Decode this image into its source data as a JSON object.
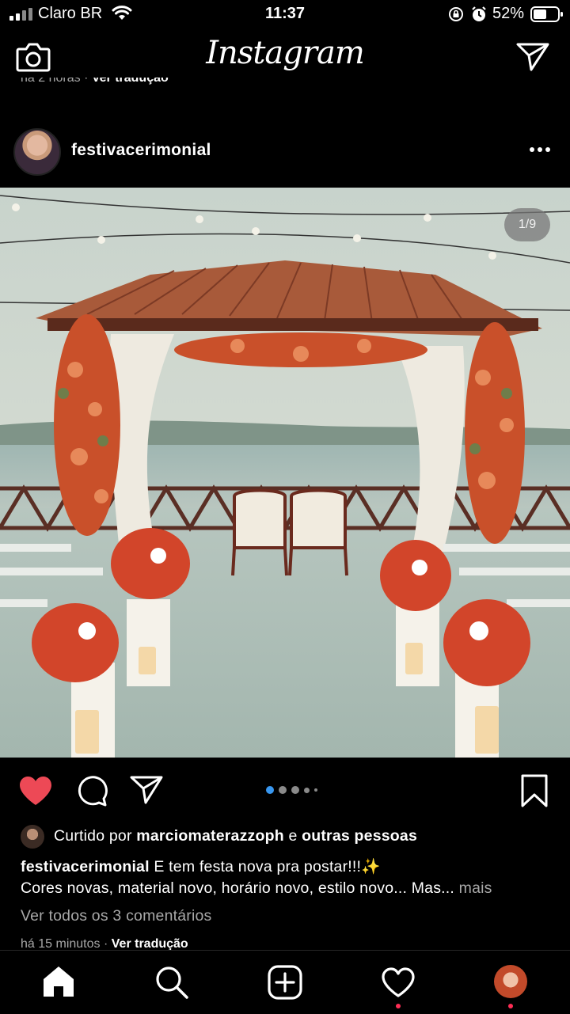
{
  "status_bar": {
    "carrier": "Claro BR",
    "time": "11:37",
    "battery_percent": "52%",
    "icons": [
      "signal-icon",
      "wifi-icon",
      "screen-lock-icon",
      "alarm-icon",
      "battery-icon"
    ]
  },
  "top_nav": {
    "logo": "Instagram",
    "icons": [
      "camera-icon",
      "direct-message-icon"
    ]
  },
  "previous_post": {
    "time_ago": "há 2 horas",
    "translate_label": "Ver tradução"
  },
  "post": {
    "username": "festivacerimonial",
    "photo_counter": "1/9",
    "carousel": {
      "current_index": 1,
      "dot_count": 5
    },
    "liked": true,
    "liked_by_prefix": "Curtido por",
    "liked_by_user": "marciomaterazzoph",
    "liked_by_suffix_connector": "e",
    "liked_by_others": "outras pessoas",
    "caption_username": "festivacerimonial",
    "caption_text": "E tem festa nova pra postar!!!✨",
    "caption_line2": "Cores novas, material novo, horário novo, estilo novo... Mas...",
    "more_label": "mais",
    "view_comments": "Ver todos os 3 comentários",
    "time_ago": "há 15 minutos",
    "translate_label": "Ver tradução"
  },
  "tab_bar": {
    "tabs": [
      "home-icon",
      "search-icon",
      "new-post-icon",
      "activity-icon",
      "profile-avatar"
    ],
    "active": "home-icon"
  },
  "colors": {
    "background": "#000000",
    "like_red": "#ed4956",
    "carousel_active": "#3897f0",
    "muted_text": "#a8a8a8",
    "notification_dot": "#ff2d55"
  }
}
